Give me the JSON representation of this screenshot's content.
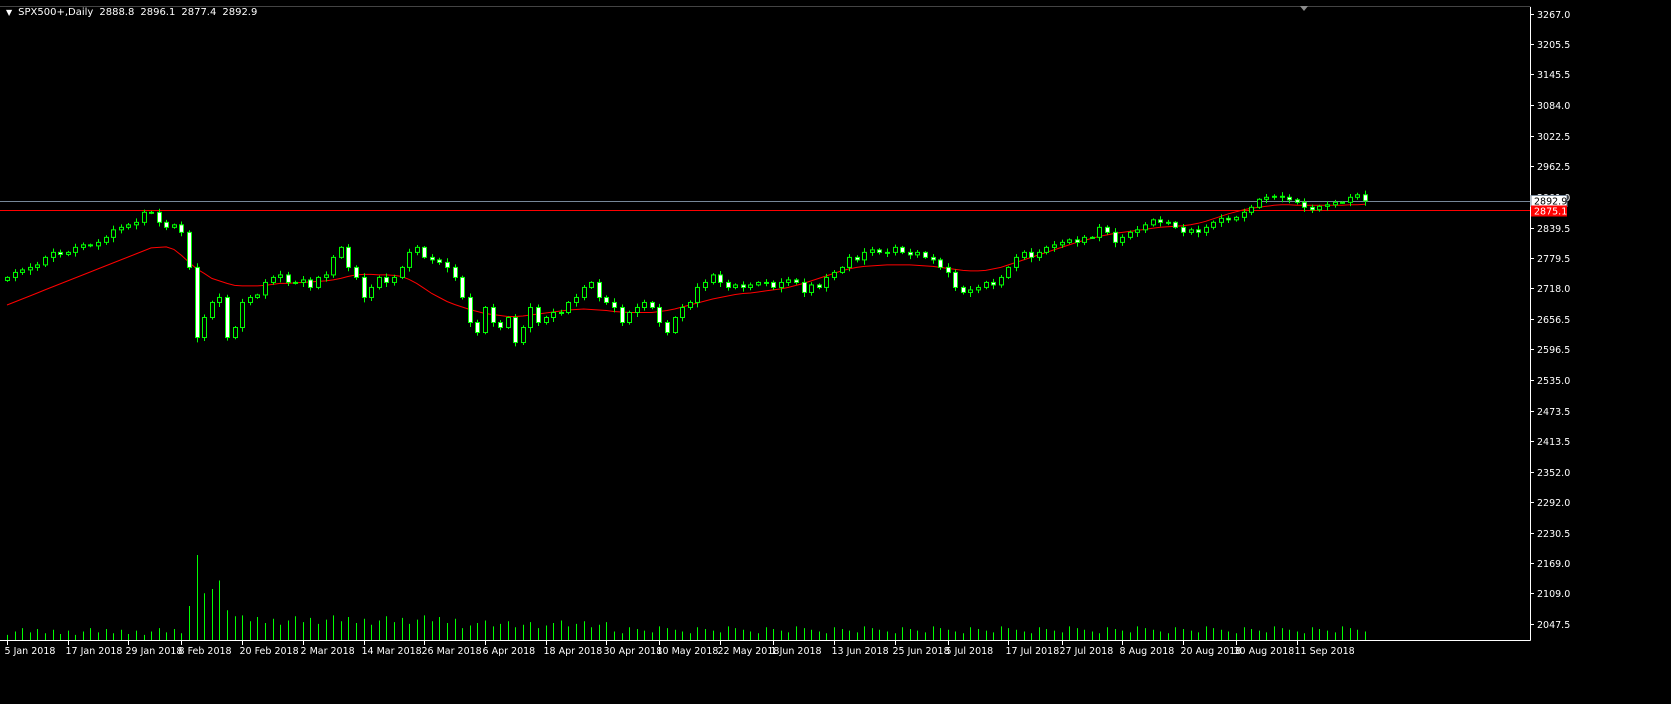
{
  "header": {
    "symbol": "SPX500+",
    "timeframe": "Daily",
    "open": "2888.8",
    "high": "2896.1",
    "low": "2877.4",
    "close": "2892.9"
  },
  "price_tags": {
    "bid": "2892.9",
    "line": "2875.1"
  },
  "colors": {
    "background": "#000000",
    "axis": "#ffffff",
    "bull_candle_border": "#00ff00",
    "bull_candle_fill": "#000000",
    "bear_candle_fill": "#ffffff",
    "volume": "#00ff00",
    "moving_average": "#ff0000",
    "horizontal_line": "#ff0000",
    "bid_line": "#778899"
  },
  "chart_data": {
    "type": "candlestick",
    "ylim": [
      2016.0,
      3280.0
    ],
    "y_ticks": [
      "3267.0",
      "3205.5",
      "3145.5",
      "3084.0",
      "3022.5",
      "2962.5",
      "2901.0",
      "2839.5",
      "2779.5",
      "2718.0",
      "2656.5",
      "2596.5",
      "2535.0",
      "2473.5",
      "2413.5",
      "2352.0",
      "2292.0",
      "2230.5",
      "2169.0",
      "2109.0",
      "2047.5"
    ],
    "x_ticks": [
      "5 Jan 2018",
      "17 Jan 2018",
      "29 Jan 2018",
      "8 Feb 2018",
      "20 Feb 2018",
      "2 Mar 2018",
      "14 Mar 2018",
      "26 Mar 2018",
      "6 Apr 2018",
      "18 Apr 2018",
      "30 Apr 2018",
      "10 May 2018",
      "22 May 2018",
      "1 Jun 2018",
      "13 Jun 2018",
      "25 Jun 2018",
      "5 Jul 2018",
      "17 Jul 2018",
      "27 Jul 2018",
      "8 Aug 2018",
      "20 Aug 2018",
      "30 Aug 2018",
      "11 Sep 2018"
    ],
    "x_tick_bar_index": [
      0,
      8,
      16,
      23,
      31,
      39,
      47,
      55,
      63,
      71,
      79,
      86,
      94,
      101,
      109,
      117,
      124,
      132,
      139,
      147,
      155,
      162,
      170
    ],
    "horizontal_line": 2875.1,
    "bid": 2892.9,
    "close": [
      2740,
      2750,
      2755,
      2760,
      2765,
      2780,
      2790,
      2786,
      2790,
      2800,
      2805,
      2803,
      2810,
      2820,
      2835,
      2840,
      2845,
      2850,
      2870,
      2870,
      2850,
      2840,
      2845,
      2830,
      2760,
      2620,
      2660,
      2690,
      2700,
      2620,
      2640,
      2690,
      2700,
      2705,
      2730,
      2740,
      2745,
      2730,
      2730,
      2735,
      2720,
      2740,
      2745,
      2780,
      2800,
      2760,
      2740,
      2700,
      2720,
      2740,
      2730,
      2740,
      2760,
      2790,
      2800,
      2780,
      2775,
      2770,
      2760,
      2740,
      2700,
      2650,
      2630,
      2680,
      2650,
      2640,
      2660,
      2610,
      2640,
      2680,
      2650,
      2660,
      2670,
      2670,
      2690,
      2700,
      2720,
      2730,
      2700,
      2690,
      2680,
      2650,
      2670,
      2680,
      2690,
      2680,
      2650,
      2630,
      2660,
      2680,
      2690,
      2720,
      2730,
      2745,
      2730,
      2720,
      2725,
      2720,
      2725,
      2730,
      2730,
      2720,
      2730,
      2735,
      2730,
      2710,
      2725,
      2720,
      2740,
      2750,
      2760,
      2780,
      2775,
      2790,
      2795,
      2790,
      2790,
      2800,
      2790,
      2785,
      2790,
      2780,
      2775,
      2760,
      2750,
      2720,
      2710,
      2715,
      2720,
      2730,
      2725,
      2740,
      2760,
      2780,
      2790,
      2780,
      2790,
      2800,
      2805,
      2810,
      2815,
      2810,
      2820,
      2820,
      2840,
      2830,
      2810,
      2820,
      2830,
      2835,
      2845,
      2855,
      2850,
      2850,
      2840,
      2830,
      2835,
      2830,
      2840,
      2850,
      2858,
      2855,
      2860,
      2870,
      2880,
      2896,
      2900,
      2902,
      2900,
      2895,
      2890,
      2880,
      2875,
      2882,
      2885,
      2890,
      2890,
      2900,
      2905,
      2892.9
    ],
    "moving_average": [
      2685,
      2691,
      2697,
      2703,
      2709,
      2715,
      2721,
      2727,
      2733,
      2739,
      2745,
      2751,
      2757,
      2763,
      2769,
      2775,
      2781,
      2787,
      2793,
      2799,
      2800,
      2801,
      2796,
      2784,
      2770,
      2757,
      2748,
      2738,
      2733,
      2728,
      2724,
      2723,
      2723,
      2723,
      2724,
      2726,
      2728,
      2728,
      2729,
      2730,
      2731,
      2732,
      2733,
      2735,
      2738,
      2742,
      2745,
      2746,
      2746,
      2745,
      2745,
      2744,
      2742,
      2736,
      2728,
      2718,
      2708,
      2700,
      2692,
      2686,
      2681,
      2676,
      2672,
      2668,
      2666,
      2664,
      2662,
      2662,
      2663,
      2665,
      2667,
      2669,
      2671,
      2673,
      2675,
      2676,
      2677,
      2676,
      2675,
      2674,
      2672,
      2671,
      2670,
      2670,
      2670,
      2670,
      2672,
      2674,
      2677,
      2681,
      2685,
      2689,
      2693,
      2697,
      2700,
      2703,
      2706,
      2708,
      2709,
      2711,
      2713,
      2715,
      2717,
      2720,
      2724,
      2728,
      2733,
      2738,
      2743,
      2748,
      2753,
      2757,
      2760,
      2762,
      2763,
      2764,
      2765,
      2765,
      2765,
      2765,
      2764,
      2763,
      2762,
      2760,
      2758,
      2756,
      2754,
      2753,
      2753,
      2754,
      2757,
      2760,
      2765,
      2770,
      2775,
      2780,
      2785,
      2790,
      2795,
      2800,
      2805,
      2810,
      2814,
      2818,
      2822,
      2825,
      2828,
      2830,
      2832,
      2834,
      2836,
      2838,
      2840,
      2841,
      2842,
      2843,
      2845,
      2848,
      2852,
      2857,
      2862,
      2867,
      2871,
      2875,
      2878,
      2880,
      2882,
      2884,
      2885,
      2885,
      2884,
      2884,
      2884,
      2884,
      2884,
      2884,
      2884,
      2885,
      2885,
      2886
    ],
    "volume_ylim": [
      0,
      100
    ]
  }
}
